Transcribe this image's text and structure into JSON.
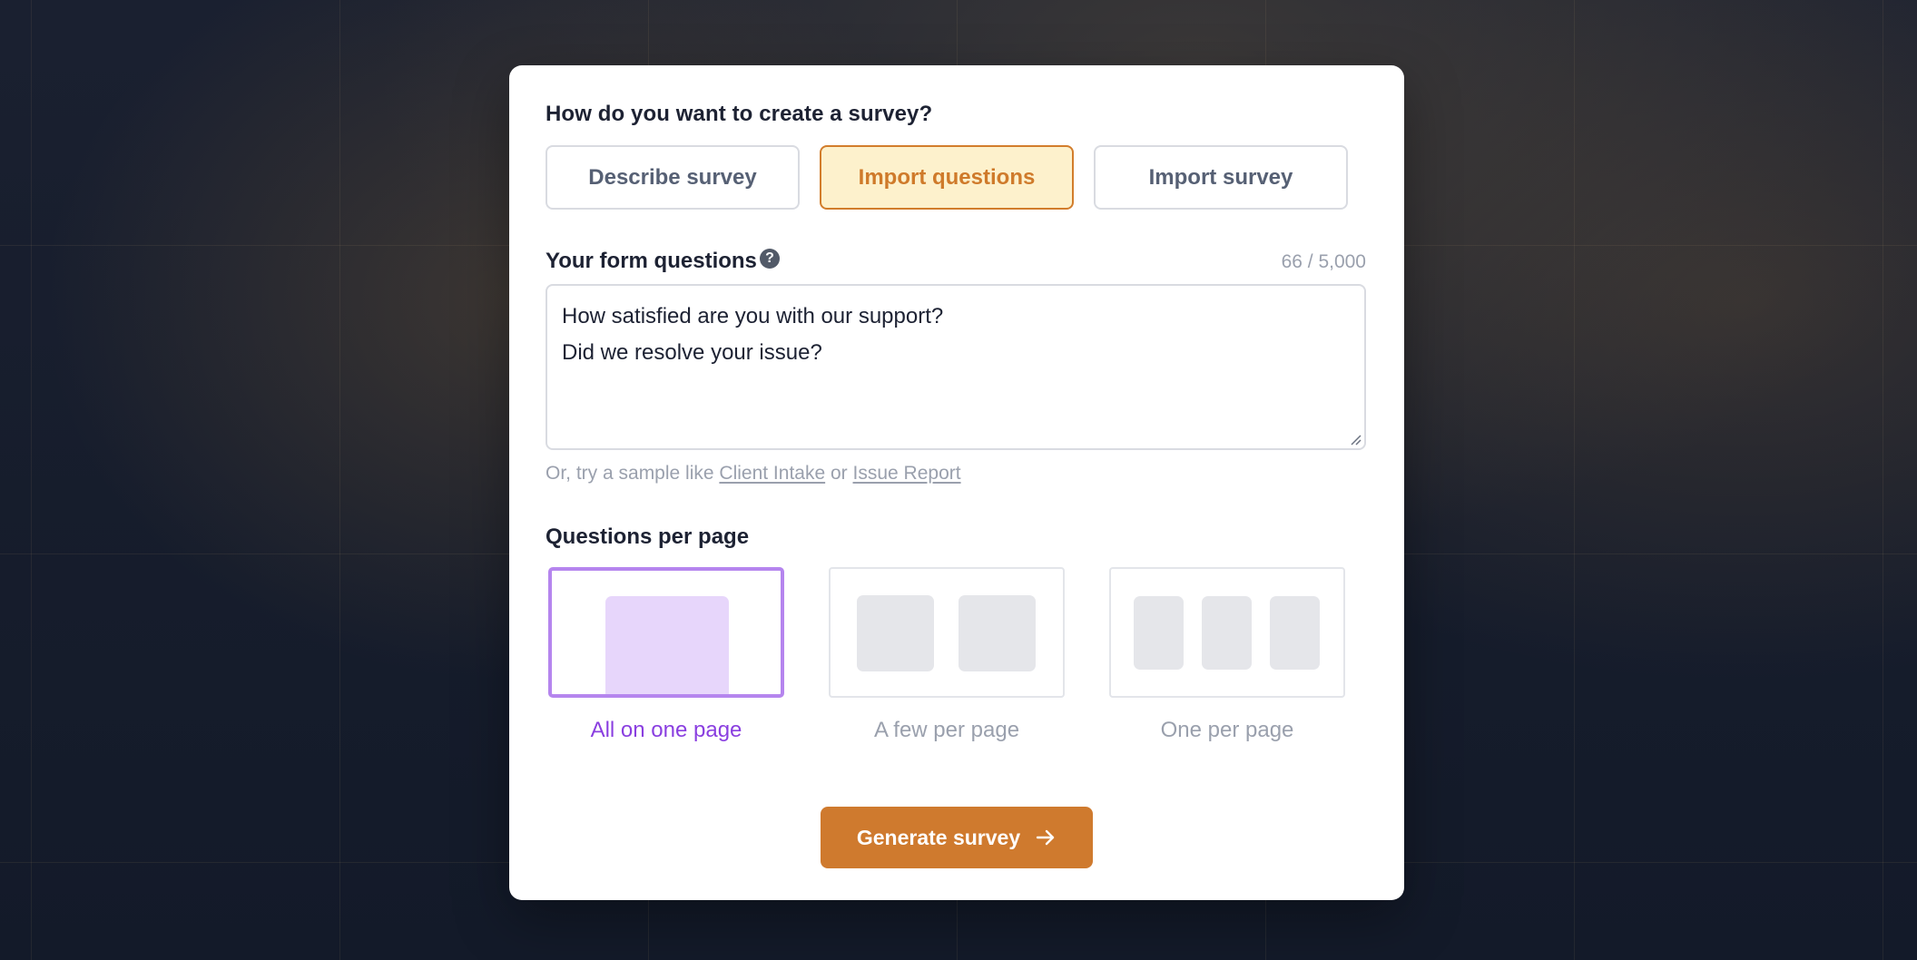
{
  "dialog": {
    "heading": "How do you want to create a survey?",
    "modes": [
      {
        "label": "Describe survey",
        "active": false
      },
      {
        "label": "Import questions",
        "active": true
      },
      {
        "label": "Import survey",
        "active": false
      }
    ],
    "questions_field": {
      "label": "Your form questions",
      "help_icon": "question-circle-icon",
      "counter": "66 / 5,000",
      "lines": [
        "How satisfied are you with our support?",
        "Did we resolve your issue?"
      ]
    },
    "samples": {
      "prefix": "Or, try a sample like",
      "link1": "Client Intake",
      "joiner": "or",
      "link2": "Issue Report"
    },
    "per_page": {
      "label": "Questions per page",
      "options": [
        {
          "label": "All on one page",
          "selected": true
        },
        {
          "label": "A few per page",
          "selected": false
        },
        {
          "label": "One per page",
          "selected": false
        }
      ]
    },
    "generate": {
      "label": "Generate survey",
      "icon": "arrow-right-icon"
    }
  },
  "colors": {
    "accent": "#cf7a2e",
    "accent_soft": "#fdf1cc",
    "selected_purple": "#b585ee",
    "selected_text": "#8a3fe0",
    "background": "#141a2a"
  }
}
